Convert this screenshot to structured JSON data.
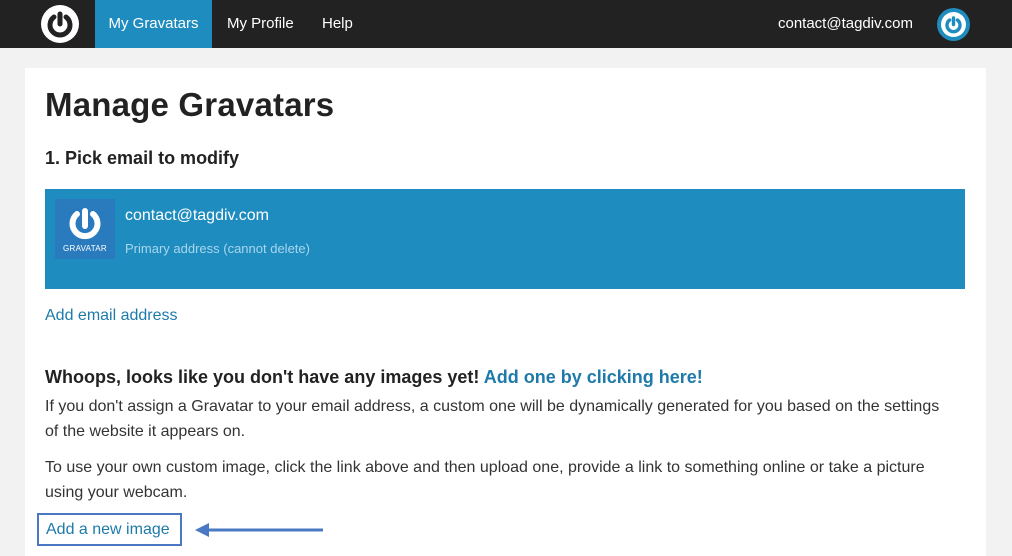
{
  "nav": {
    "items": [
      {
        "label": "My Gravatars",
        "active": true
      },
      {
        "label": "My Profile",
        "active": false
      },
      {
        "label": "Help",
        "active": false
      }
    ],
    "account_email": "contact@tagdiv.com",
    "logo_icon": "gravatar-logo-icon",
    "avatar_icon": "gravatar-avatar-icon"
  },
  "main": {
    "title": "Manage Gravatars",
    "step_title": "1. Pick email to modify",
    "email_entry": {
      "address": "contact@tagdiv.com",
      "note": "Primary address (cannot delete)",
      "avatar_label": "GRAVATAR"
    },
    "add_email_label": "Add email address",
    "whoops_text": "Whoops, looks like you don't have any images yet!",
    "whoops_link": "Add one by clicking here!",
    "paragraph1": "If you don't assign a Gravatar to your email address, a custom one will be dynamically generated for you based on the settings of the website it appears on.",
    "paragraph2": "To use your own custom image, click the link above and then upload one, provide a link to something online or take a picture using your webcam.",
    "add_image_label": "Add a new image"
  },
  "colors": {
    "topbar": "#222222",
    "accent": "#1e8cbe",
    "link": "#1e7aaa",
    "highlight_border": "#4a78c2"
  }
}
